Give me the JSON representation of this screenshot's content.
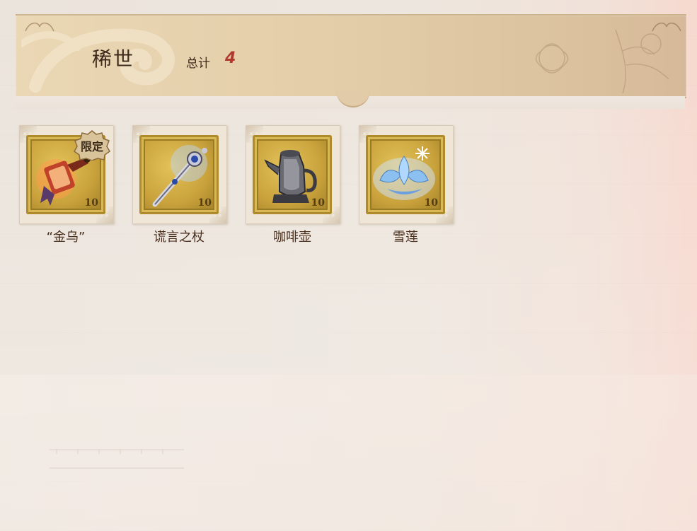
{
  "header": {
    "category": "稀世",
    "total_label": "总计",
    "total_count": "4"
  },
  "items": [
    {
      "name": "“金乌”",
      "icon": "golden-crow-lantern-icon",
      "stamp_value": "10",
      "badge": "限定"
    },
    {
      "name": "谎言之杖",
      "icon": "scepter-icon",
      "stamp_value": "10"
    },
    {
      "name": "咖啡壶",
      "icon": "coffee-pot-icon",
      "stamp_value": "10"
    },
    {
      "name": "雪莲",
      "icon": "snow-lotus-icon",
      "stamp_value": "10"
    }
  ],
  "colors": {
    "accent_count": "#b03a2e",
    "title_text": "#3e2a1c",
    "banner": "#e5cfab",
    "stamp_gold": "#c9a23c"
  }
}
